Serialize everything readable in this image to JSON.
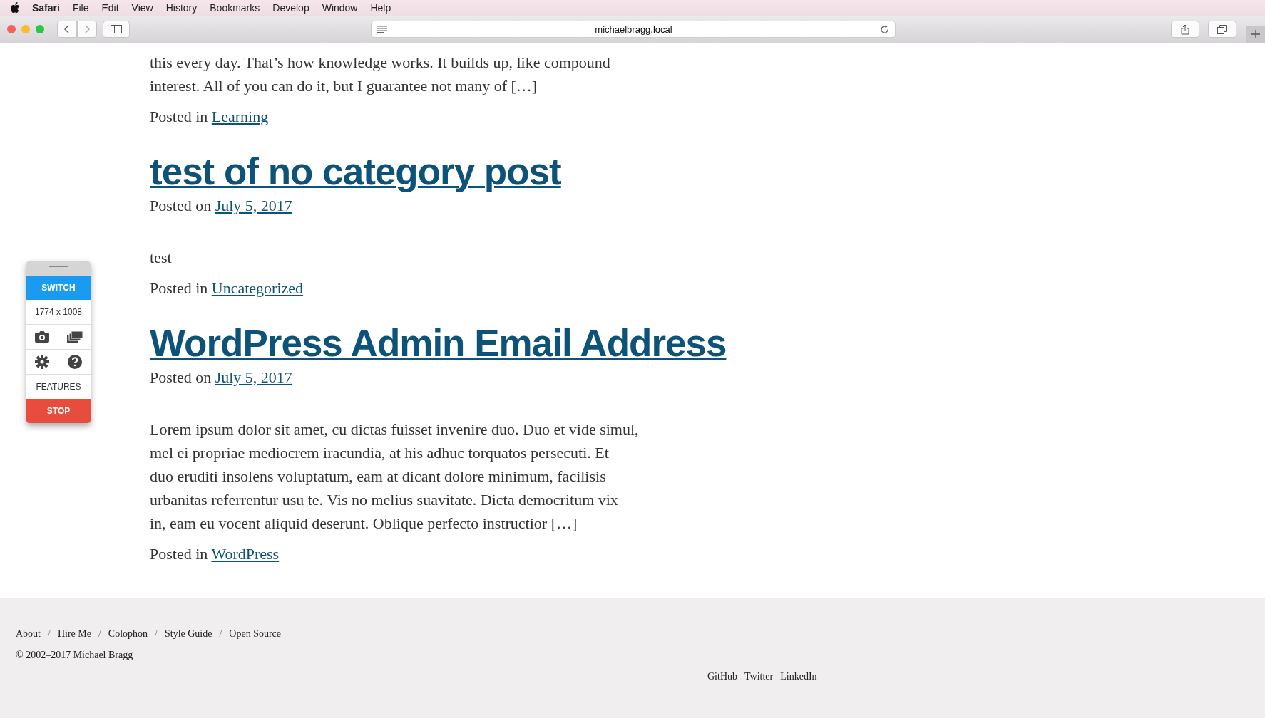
{
  "menubar": {
    "app": "Safari",
    "items": [
      "File",
      "Edit",
      "View",
      "History",
      "Bookmarks",
      "Develop",
      "Window",
      "Help"
    ]
  },
  "browser": {
    "url": "michaelbragg.local"
  },
  "posts": [
    {
      "excerpt_lines": [
        "this every day. That’s how knowledge works. It builds up, like compound",
        "interest. All of you can do it, but I guarantee not many of […]"
      ],
      "category_label": "Posted in",
      "category": "Learning"
    },
    {
      "title": "test of no category post",
      "posted_label": "Posted on",
      "date": "July 5, 2017",
      "excerpt_lines": [
        "test"
      ],
      "category_label": "Posted in",
      "category": "Uncategorized"
    },
    {
      "title": "WordPress Admin Email Address",
      "posted_label": "Posted on",
      "date": "July 5, 2017",
      "excerpt_lines": [
        "Lorem ipsum dolor sit amet, cu dictas fuisset invenire duo. Duo et vide simul,",
        "mel ei propriae mediocrem iracundia, at his adhuc torquatos persecuti. Et",
        "duo eruditi insolens voluptatum, eam at dicant dolore minimum, facilisis",
        "urbanitas referrentur usu te. Vis no melius suavitate. Dicta democritum vix",
        "in, eam eu vocent aliquid deserunt. Oblique perfecto instructior […]"
      ],
      "category_label": "Posted in",
      "category": "WordPress"
    }
  ],
  "widget": {
    "switch": "SWITCH",
    "size": "1774 x 1008",
    "features": "FEATURES",
    "stop": "STOP"
  },
  "footer": {
    "nav": [
      {
        "kind": "link",
        "label": "About"
      },
      {
        "kind": "separator",
        "label": "/"
      },
      {
        "kind": "link",
        "label": "Hire Me"
      },
      {
        "kind": "separator",
        "label": "/"
      },
      {
        "kind": "link",
        "label": "Colophon"
      },
      {
        "kind": "separator",
        "label": "/"
      },
      {
        "kind": "link",
        "label": "Style Guide"
      },
      {
        "kind": "separator",
        "label": "/"
      },
      {
        "kind": "link",
        "label": "Open Source"
      }
    ],
    "copyright": "© 2002–2017 Michael Bragg",
    "social": [
      "GitHub",
      "Twitter",
      "LinkedIn"
    ]
  }
}
